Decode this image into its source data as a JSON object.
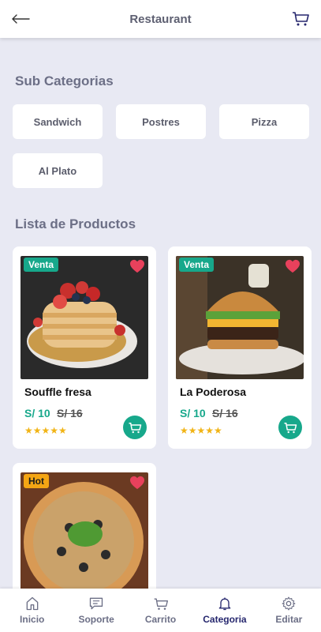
{
  "header": {
    "title": "Restaurant"
  },
  "subcategories": {
    "title": "Sub Categorias",
    "items": [
      "Sandwich",
      "Postres",
      "Pizza",
      "Al Plato"
    ]
  },
  "products": {
    "title": "Lista de Productos",
    "items": [
      {
        "badge": "Venta",
        "name": "Souffle fresa",
        "price": "S/ 10",
        "old_price": "S/ 16",
        "rating": 5,
        "stars": "★★★★★"
      },
      {
        "badge": "Venta",
        "name": "La Poderosa",
        "price": "S/ 10",
        "old_price": "S/ 16",
        "rating": 5,
        "stars": "★★★★★"
      },
      {
        "badge": "Hot"
      }
    ]
  },
  "nav": {
    "items": [
      {
        "label": "Inicio",
        "icon": "home-icon"
      },
      {
        "label": "Soporte",
        "icon": "chat-icon"
      },
      {
        "label": "Carrito",
        "icon": "cart-icon"
      },
      {
        "label": "Categoria",
        "icon": "bell-icon"
      },
      {
        "label": "Editar",
        "icon": "gear-icon"
      }
    ],
    "active": "Categoria"
  },
  "colors": {
    "accent": "#17a88b",
    "hot": "#f4a514",
    "heart": "#e8415c",
    "nav_active": "#26276e"
  }
}
